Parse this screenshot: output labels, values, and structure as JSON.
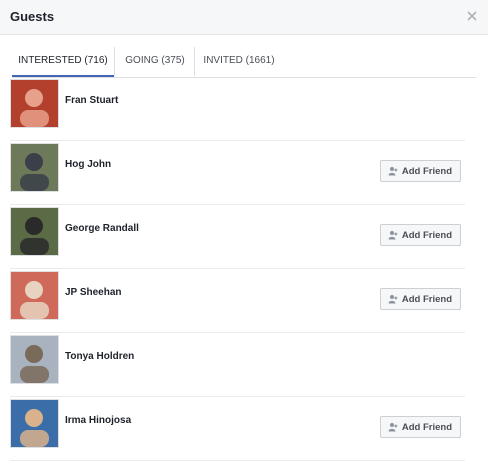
{
  "dialog": {
    "title": "Guests",
    "close_icon": "close-icon"
  },
  "tabs": [
    {
      "label": "INTERESTED (716)",
      "active": true
    },
    {
      "label": "GOING (375)",
      "active": false
    },
    {
      "label": "INVITED (1661)",
      "active": false
    }
  ],
  "guests": [
    {
      "name": "Fran Stuart",
      "has_add_friend": false,
      "avatar_colors": [
        "#b3402c",
        "#e7a08a"
      ]
    },
    {
      "name": "Hog John",
      "has_add_friend": true,
      "add_friend_label": "Add Friend",
      "avatar_colors": [
        "#6c7a5a",
        "#3a3f4a"
      ]
    },
    {
      "name": "George Randall",
      "has_add_friend": true,
      "add_friend_label": "Add Friend",
      "avatar_colors": [
        "#5b6b46",
        "#2a2a2a"
      ]
    },
    {
      "name": "JP Sheehan",
      "has_add_friend": true,
      "add_friend_label": "Add Friend",
      "avatar_colors": [
        "#cf6a5a",
        "#e8d2c0"
      ]
    },
    {
      "name": "Tonya Holdren",
      "has_add_friend": false,
      "avatar_colors": [
        "#a9b3bf",
        "#7a6a5a"
      ]
    },
    {
      "name": "Irma Hinojosa",
      "has_add_friend": true,
      "add_friend_label": "Add Friend",
      "avatar_colors": [
        "#3b6ea8",
        "#d9b28c"
      ]
    }
  ],
  "colors": {
    "accent": "#4267b2",
    "header_bg": "#f6f7f9",
    "button_bg": "#f6f7f9"
  }
}
